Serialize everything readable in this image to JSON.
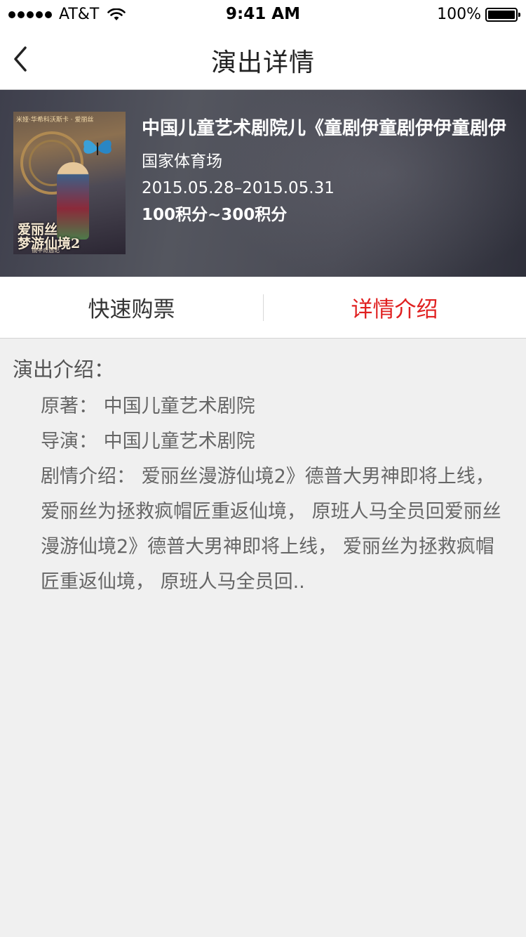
{
  "status_bar": {
    "carrier": "AT&T",
    "time": "9:41 AM",
    "battery": "100%"
  },
  "nav": {
    "title": "演出详情"
  },
  "show": {
    "poster": {
      "top_line": "米娅·华希科沃斯卡 · 爱丽丝",
      "title_line1": "爱丽丝",
      "title_line2": "梦游仙境2",
      "subtitle": "镜中奇遇记"
    },
    "title": "中国儿童艺术剧院儿《童剧伊童剧伊伊童剧伊",
    "venue": "国家体育场",
    "date": "2015.05.28–2015.05.31",
    "price": "100积分~300积分"
  },
  "tabs": [
    {
      "label": "快速购票",
      "active": false
    },
    {
      "label": "详情介绍",
      "active": true
    }
  ],
  "intro": {
    "heading": "演出介绍：",
    "original_work": "原著：  中国儿童艺术剧院",
    "director": "导演：  中国儿童艺术剧院",
    "plot": "剧情介绍：  爱丽丝漫游仙境2》德普大男神即将上线，  爱丽丝为拯救疯帽匠重返仙境，  原班人马全员回爱丽丝漫游仙境2》德普大男神即将上线，  爱丽丝为拯救疯帽匠重返仙境，  原班人马全员回.."
  },
  "colors": {
    "accent": "#e02020",
    "background": "#f0f0f0"
  },
  "icons": {
    "back": "chevron-left-icon",
    "wifi": "wifi-icon",
    "battery": "battery-icon",
    "signal": "signal-dots-icon"
  }
}
